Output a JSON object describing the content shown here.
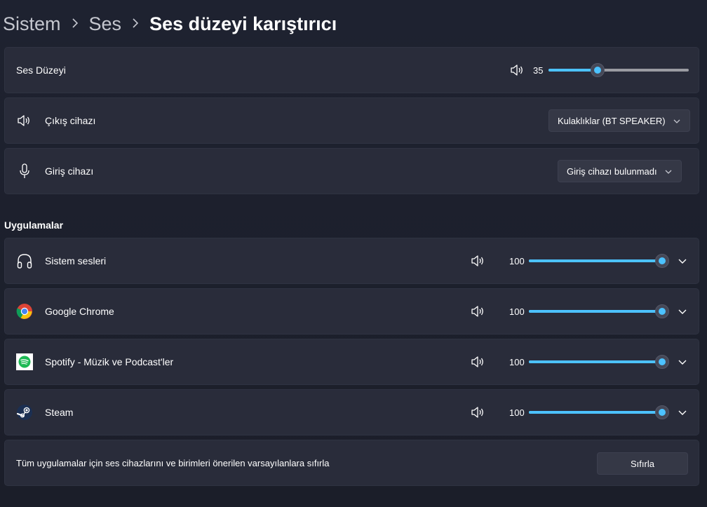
{
  "breadcrumb": {
    "items": [
      "Sistem",
      "Ses"
    ],
    "current": "Ses düzeyi karıştırıcı"
  },
  "master": {
    "label": "Ses Düzeyi",
    "value": "35",
    "level": 35
  },
  "output": {
    "label": "Çıkış cihazı",
    "selected": "Kulaklıklar (BT SPEAKER)"
  },
  "input": {
    "label": "Giriş cihazı",
    "selected": "Giriş cihazı bulunmadı"
  },
  "apps_title": "Uygulamalar",
  "apps": [
    {
      "name": "Sistem sesleri",
      "value": "100",
      "level": 100,
      "icon": "headphones-icon"
    },
    {
      "name": "Google Chrome",
      "value": "100",
      "level": 100,
      "icon": "chrome-icon"
    },
    {
      "name": "Spotify - Müzik ve Podcast'ler",
      "value": "100",
      "level": 100,
      "icon": "spotify-icon"
    },
    {
      "name": "Steam",
      "value": "100",
      "level": 100,
      "icon": "steam-icon"
    }
  ],
  "reset": {
    "text": "Tüm uygulamalar için ses cihazlarını ve birimleri önerilen varsayılanlara sıfırla",
    "button": "Sıfırla"
  },
  "colors": {
    "accent": "#4cc2ff",
    "card": "#292c3a",
    "background": "#1c1f2b"
  }
}
